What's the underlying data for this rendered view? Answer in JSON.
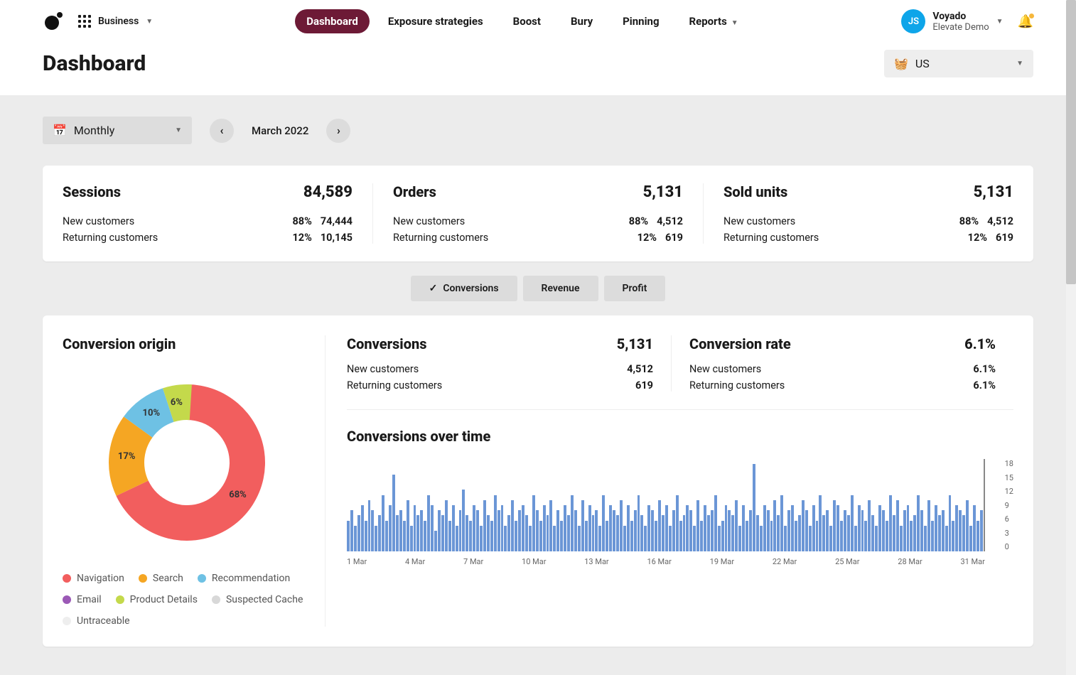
{
  "header": {
    "business_label": "Business",
    "nav": [
      "Dashboard",
      "Exposure strategies",
      "Boost",
      "Bury",
      "Pinning",
      "Reports"
    ],
    "active_nav": "Dashboard",
    "user": {
      "initials": "JS",
      "name": "Voyado",
      "sub": "Elevate Demo"
    }
  },
  "page_title": "Dashboard",
  "market": {
    "label": "US"
  },
  "period": {
    "granularity": "Monthly",
    "label": "March 2022"
  },
  "stats": [
    {
      "title": "Sessions",
      "total": "84,589",
      "rows": [
        {
          "label": "New customers",
          "pct": "88%",
          "val": "74,444"
        },
        {
          "label": "Returning customers",
          "pct": "12%",
          "val": "10,145"
        }
      ]
    },
    {
      "title": "Orders",
      "total": "5,131",
      "rows": [
        {
          "label": "New customers",
          "pct": "88%",
          "val": "4,512"
        },
        {
          "label": "Returning customers",
          "pct": "12%",
          "val": "619"
        }
      ]
    },
    {
      "title": "Sold units",
      "total": "5,131",
      "rows": [
        {
          "label": "New customers",
          "pct": "88%",
          "val": "4,512"
        },
        {
          "label": "Returning customers",
          "pct": "12%",
          "val": "619"
        }
      ]
    }
  ],
  "segments": [
    "Conversions",
    "Revenue",
    "Profit"
  ],
  "active_segment": "Conversions",
  "conversion_origin": {
    "title": "Conversion origin",
    "legend": [
      {
        "name": "Navigation",
        "color": "#f25e5e"
      },
      {
        "name": "Search",
        "color": "#f5a623"
      },
      {
        "name": "Recommendation",
        "color": "#6ec1e4"
      },
      {
        "name": "Email",
        "color": "#9b59b6"
      },
      {
        "name": "Product Details",
        "color": "#c4d94b"
      },
      {
        "name": "Suspected Cache",
        "color": "#d8d8d8"
      },
      {
        "name": "Untraceable",
        "color": "#eeeeee"
      }
    ]
  },
  "mini": [
    {
      "title": "Conversions",
      "total": "5,131",
      "rows": [
        {
          "label": "New customers",
          "val": "4,512"
        },
        {
          "label": "Returning customers",
          "val": "619"
        }
      ]
    },
    {
      "title": "Conversion rate",
      "total": "6.1%",
      "rows": [
        {
          "label": "New customers",
          "val": "6.1%"
        },
        {
          "label": "Returning customers",
          "val": "6.1%"
        }
      ]
    }
  ],
  "timechart_title": "Conversions over time",
  "chart_data": [
    {
      "type": "pie",
      "title": "Conversion origin",
      "series": [
        {
          "name": "Navigation",
          "value": 68,
          "color": "#f25e5e"
        },
        {
          "name": "Search",
          "value": 17,
          "color": "#f5a623"
        },
        {
          "name": "Recommendation",
          "value": 10,
          "color": "#6ec1e4"
        },
        {
          "name": "Product Details",
          "value": 6,
          "color": "#c4d94b"
        },
        {
          "name": "Email",
          "value": 0,
          "color": "#9b59b6"
        },
        {
          "name": "Suspected Cache",
          "value": 0,
          "color": "#d8d8d8"
        },
        {
          "name": "Untraceable",
          "value": 0,
          "color": "#eeeeee"
        }
      ]
    },
    {
      "type": "bar",
      "title": "Conversions over time",
      "xlabel": "",
      "ylabel": "",
      "ylim": [
        0,
        18
      ],
      "y_ticks": [
        0,
        3,
        6,
        9,
        12,
        15,
        18
      ],
      "x_ticks": [
        "1 Mar",
        "4 Mar",
        "7 Mar",
        "10 Mar",
        "13 Mar",
        "16 Mar",
        "19 Mar",
        "22 Mar",
        "25 Mar",
        "28 Mar",
        "31 Mar"
      ],
      "values": [
        6,
        8,
        5,
        7,
        9,
        6,
        10,
        8,
        5,
        7,
        11,
        6,
        9,
        15,
        7,
        8,
        6,
        10,
        5,
        9,
        7,
        8,
        6,
        11,
        9,
        4,
        8,
        7,
        10,
        6,
        9,
        5,
        8,
        12,
        7,
        6,
        9,
        8,
        5,
        10,
        7,
        6,
        11,
        8,
        9,
        5,
        7,
        10,
        6,
        8,
        9,
        7,
        5,
        11,
        8,
        6,
        9,
        7,
        10,
        5,
        8,
        6,
        9,
        7,
        11,
        8,
        5,
        10,
        6,
        9,
        7,
        8,
        5,
        11,
        6,
        9,
        8,
        7,
        10,
        5,
        9,
        6,
        8,
        11,
        7,
        5,
        9,
        8,
        6,
        10,
        7,
        9,
        5,
        8,
        11,
        6,
        7,
        9,
        8,
        5,
        10,
        6,
        9,
        7,
        8,
        11,
        5,
        6,
        9,
        8,
        7,
        10,
        5,
        9,
        6,
        8,
        17,
        7,
        5,
        9,
        8,
        6,
        10,
        7,
        11,
        5,
        8,
        9,
        6,
        7,
        10,
        8,
        5,
        9,
        6,
        11,
        7,
        8,
        5,
        10,
        9,
        6,
        8,
        7,
        11,
        5,
        9,
        8,
        6,
        10,
        7,
        5,
        9,
        8,
        6,
        11,
        7,
        10,
        5,
        8,
        9,
        6,
        7,
        11,
        8,
        5,
        10,
        6,
        9,
        7,
        8,
        5,
        11,
        6,
        9,
        8,
        7,
        10,
        5,
        9,
        6,
        8
      ]
    }
  ]
}
